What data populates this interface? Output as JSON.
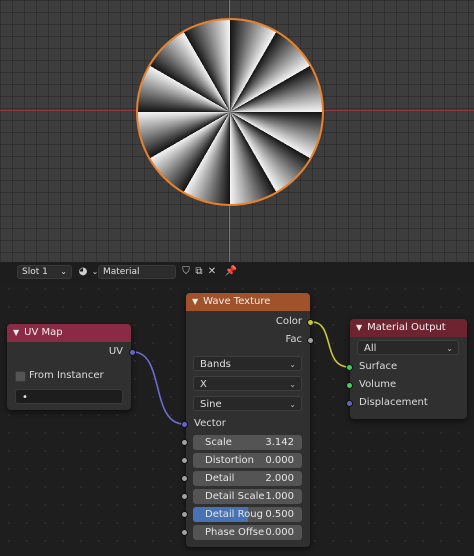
{
  "header": {
    "slot": "Slot 1",
    "material_name": "Material"
  },
  "nodes": {
    "uv_map": {
      "title": "UV Map",
      "header_color": "#8b2a44",
      "output_uv": "UV",
      "from_instancer": "From Instancer",
      "uv_name": "•"
    },
    "wave_texture": {
      "title": "Wave Texture",
      "header_color": "#a0522a",
      "output_color": "Color",
      "output_fac": "Fac",
      "wave_type": "Bands",
      "direction": "X",
      "profile": "Sine",
      "input_vector": "Vector",
      "fields": [
        {
          "label": "Scale",
          "value": "3.142"
        },
        {
          "label": "Distortion",
          "value": "0.000"
        },
        {
          "label": "Detail",
          "value": "2.000"
        },
        {
          "label": "Detail Scale",
          "value": "1.000"
        },
        {
          "label": "Detail Roug",
          "value": "0.500",
          "fill_fraction": 0.5
        },
        {
          "label": "Phase Offse",
          "value": "0.000"
        }
      ]
    },
    "material_output": {
      "title": "Material Output",
      "header_color": "#6e2430",
      "target": "All",
      "input_surface": "Surface",
      "input_volume": "Volume",
      "input_displacement": "Displacement"
    }
  },
  "colors": {
    "socket_color": "#c7c729",
    "socket_shader": "#3fcf55",
    "socket_vector": "#6363c7",
    "socket_float": "#a1a1a1",
    "selection_outline": "#e8812c"
  }
}
